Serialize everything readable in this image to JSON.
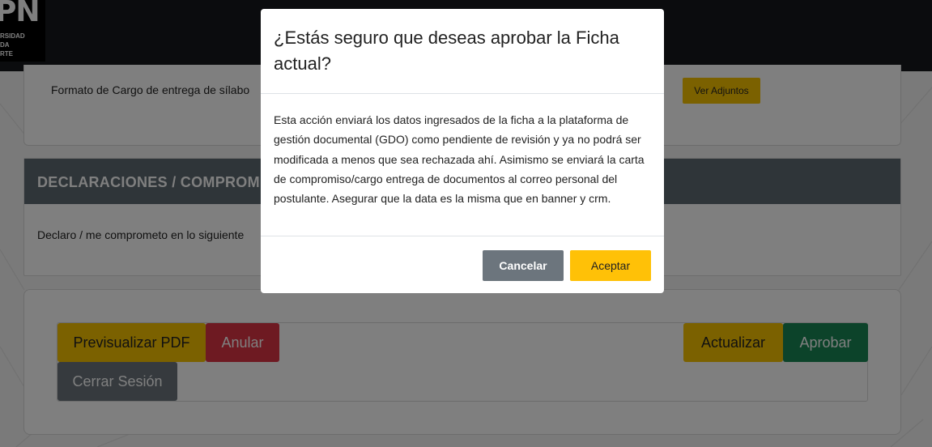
{
  "header": {
    "logo_big": "PN",
    "logo_lines": [
      "RSIDAD",
      "DA",
      "RTE"
    ]
  },
  "attachments": {
    "row_label": "Formato de Cargo de entrega de sílabo",
    "view_button": "Ver Adjuntos"
  },
  "declarations": {
    "header": "DECLARACIONES / COMPROMISOS",
    "text": "Declaro / me comprometo en lo siguiente"
  },
  "actions": {
    "preview": "Previsualizar PDF",
    "cancel": "Anular",
    "update": "Actualizar",
    "approve": "Aprobar",
    "logout": "Cerrar Sesión"
  },
  "modal": {
    "title": "¿Estás seguro que deseas aprobar la Ficha actual?",
    "body": "Esta acción enviará los datos ingresados de la ficha a la plataforma de gestión documental (GDO) como pendiente de revisión y ya no podrá ser modificada a menos que sea rechazada ahí. Asimismo se enviará la carta de compromiso/cargo entrega de documentos al correo personal del postulante. Asegurar que la data es la misma que en banner y crm.",
    "cancel_button": "Cancelar",
    "accept_button": "Aceptar"
  },
  "colors": {
    "accent_yellow": "#ffc107",
    "danger": "#dc3545",
    "success": "#198754",
    "secondary": "#6c757d",
    "section_header": "#5f6a72"
  }
}
